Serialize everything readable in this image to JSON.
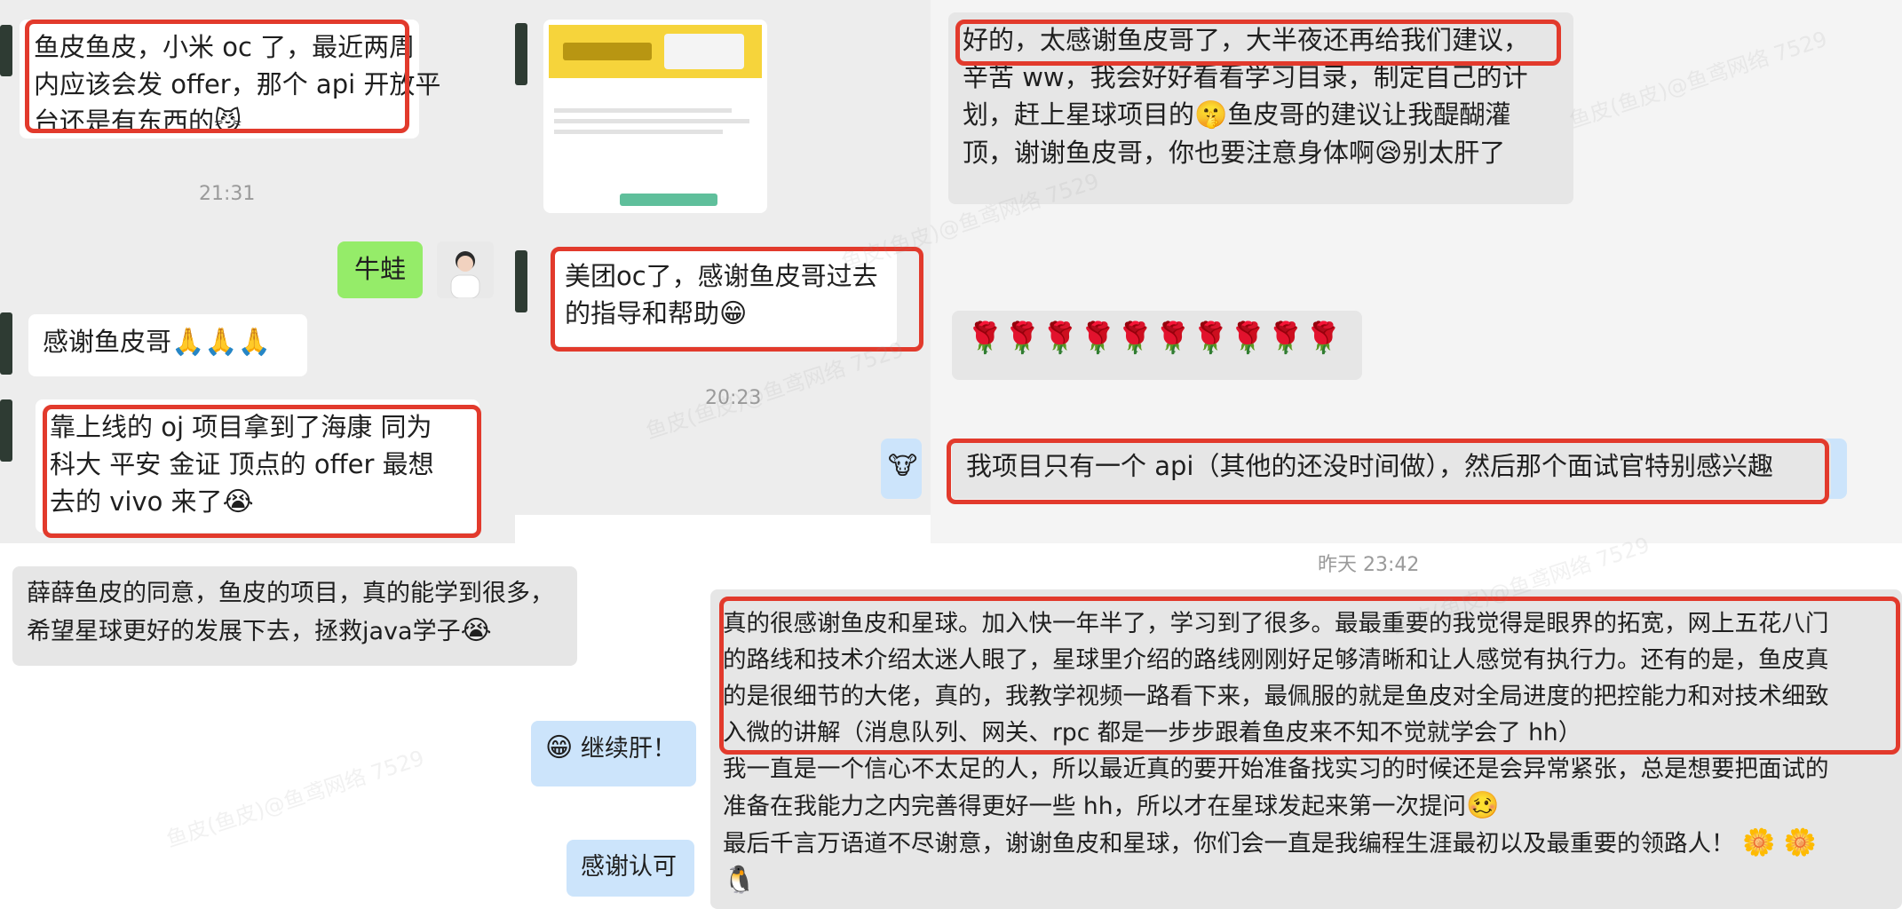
{
  "messages": {
    "xiaomi": {
      "lines": [
        "鱼皮鱼皮，小米 oc 了，最近两周",
        "内应该会发 offer，那个 api 开放平",
        "台还是有东西的"
      ],
      "emoji": "😼"
    },
    "time_2131": "21:31",
    "niuwa": "牛蛙",
    "thanks_praying": {
      "text": "感谢鱼皮哥",
      "emoji": "🙏🙏🙏"
    },
    "oj_project": {
      "lines": [
        "靠上线的 oj 项目拿到了海康  同为",
        "科大 平安 金证 顶点的 offer  最想",
        "去的 vivo 来了"
      ],
      "emoji": "😭"
    },
    "meituan": {
      "lines": [
        "美团oc了，感谢鱼皮哥过去",
        "的指导和帮助"
      ],
      "emoji": "😁"
    },
    "time_2023": "20:23",
    "goodnight": {
      "lines": [
        "好的，太感谢鱼皮哥了，大半夜还再给我们建议，",
        "辛苦 ww，我会好好看看学习目录，制定自己的计",
        "划，赶上星球项目的",
        "鱼皮哥的建议让我醍醐灌",
        "顶，谢谢鱼皮哥，你也要注意身体啊",
        "别太肝了"
      ],
      "emoji_a": "🤫",
      "emoji_b": "😪"
    },
    "roses": "🌹🌹🌹🌹🌹🌹🌹🌹🌹🌹",
    "cow": "🐮",
    "one_api": "我项目只有一个 api（其他的还没时间做），然后那个面试官特别感兴趣",
    "time_yesterday": "昨天 23:42",
    "xuexue": {
      "lines": [
        "薛薛鱼皮的同意，鱼皮的项目，真的能学到很多，",
        "希望星球更好的发展下去，拯救java学子"
      ],
      "emoji": "😭"
    },
    "keep_going": {
      "emoji": "😁",
      "text": "继续肝！"
    },
    "thanks_ack": "感谢认可",
    "long": {
      "boxed": [
        "真的很感谢鱼皮和星球。加入快一年半了，学习到了很多。最最重要的我觉得是眼界的拓宽，网上五花八门",
        "的路线和技术介绍太迷人眼了，星球里介绍的路线刚刚好足够清晰和让人感觉有执行力。还有的是，鱼皮真",
        "的是很细节的大佬，真的，我教学视频一路看下来，最佩服的就是鱼皮对全局进度的把控能力和对技术细致",
        "入微的讲解（消息队列、网关、rpc 都是一步步跟着鱼皮来不知不觉就学会了 hh）"
      ],
      "rest": [
        "我一直是一个信心不太足的人，所以最近真的要开始准备找实习的时候还是会异常紧张，总是想要把面试的",
        "准备在我能力之内完善得更好一些 hh，所以才在星球发起来第一次提问"
      ],
      "rest_emoji": "🥴",
      "last": "最后千言万语道不尽谢意，谢谢鱼皮和星球，你们会一直是我编程生涯最初以及最重要的领路人！",
      "last_emoji": "🌼 🌼",
      "penguin": "🐧"
    }
  },
  "watermark": "鱼皮(鱼皮)@鱼鸢网络 7529",
  "colors": {
    "highlight": "#e23a2c",
    "green_bubble": "#95ec69",
    "blue_bubble": "#cce4fb"
  }
}
